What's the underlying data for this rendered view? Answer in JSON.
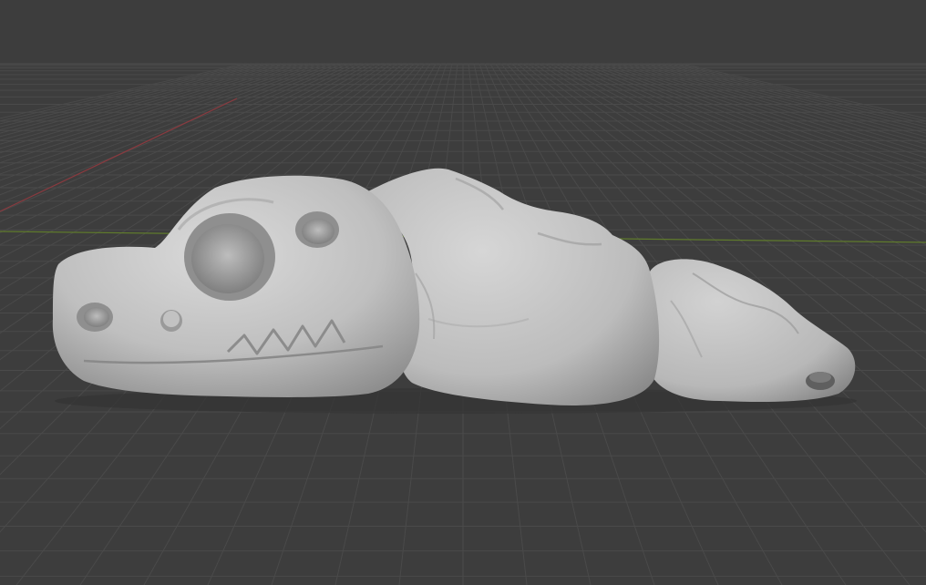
{
  "viewport": {
    "background": "#3d3d3d",
    "grid_color": "#4a4a4a",
    "grid_major_color": "#545454",
    "x_axis_color": "#8a3a3f",
    "y_axis_color": "#5f7a2c"
  },
  "model": {
    "base_color": "#c8c8c8",
    "shadow_color": "#7a7a7a",
    "highlight_color": "#dcdcdc",
    "parts": [
      "skull-segment",
      "body-segment-middle",
      "tail-segment"
    ]
  }
}
